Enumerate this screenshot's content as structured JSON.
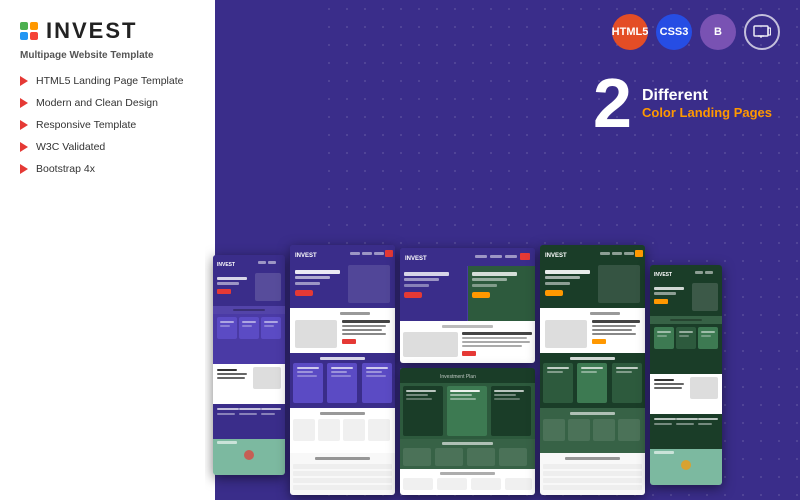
{
  "logo": {
    "text": "INVEST",
    "dots": [
      "green",
      "orange",
      "blue",
      "red"
    ]
  },
  "subtitle": "Multipage Website Template",
  "features": [
    "HTML5 Landing Page Template",
    "Modern and Clean Design",
    "Responsive Template",
    "W3C Validated",
    "Bootstrap 4x"
  ],
  "badges": [
    {
      "label": "HTML5",
      "class": "badge-html"
    },
    {
      "label": "CSS3",
      "class": "badge-css"
    },
    {
      "label": "B",
      "class": "badge-bs"
    },
    {
      "label": "⊡",
      "class": "badge-resp"
    }
  ],
  "highlight": {
    "number": "2",
    "line1": "Different",
    "line2": "Color Landing Pages"
  },
  "colors": {
    "background": "#3a2d8a",
    "white_panel": "#ffffff",
    "accent_red": "#e53935",
    "accent_orange": "#ff9800",
    "theme_purple": "#4a3aa5",
    "theme_green": "#2d5a3d"
  }
}
